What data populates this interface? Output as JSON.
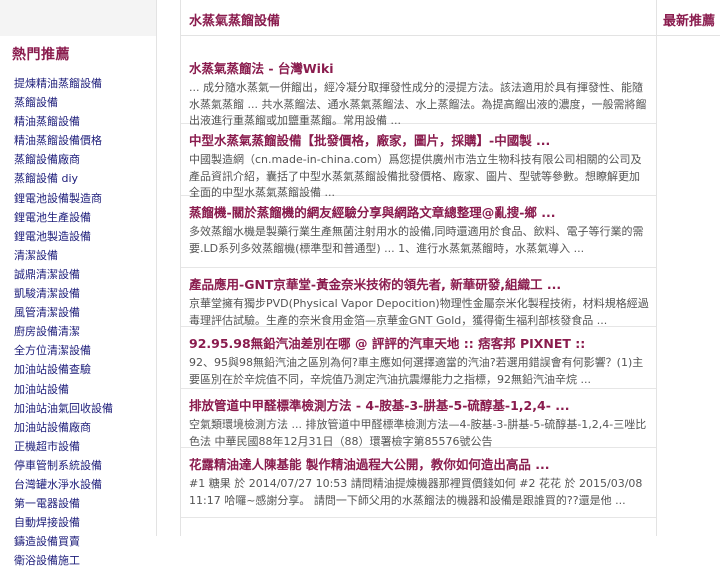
{
  "header": {
    "title": "水蒸氣蒸餾設備",
    "right_title": "最新推薦"
  },
  "sidebar": {
    "title": "熱門推薦",
    "items": [
      "提煉精油蒸餾設備",
      "蒸餾設備",
      "精油蒸餾設備",
      "精油蒸餾設備價格",
      "蒸餾設備廠商",
      "蒸餾設備 diy",
      "鋰電池設備製造商",
      "鋰電池生產設備",
      "鋰電池製造設備",
      "清潔設備",
      "誠鼎清潔設備",
      "凱駿清潔設備",
      "風管清潔設備",
      "廚房設備清潔",
      "全方位清潔設備",
      "加油站設備查驗",
      "加油站設備",
      "加油站油氣回收設備",
      "加油站設備廠商",
      "正機超市設備",
      "停車管制系統設備",
      "台灣罐水淨水設備",
      "第一電器設備",
      "自動焊接設備",
      "鑄造設備買賣",
      "衛浴設備施工"
    ]
  },
  "results": [
    {
      "title": "水蒸氣蒸餾法 - 台灣Wiki",
      "snippet": "... 成分隨水蒸氣一併餾出，經冷凝分取揮發性成分的浸提方法。該法適用於具有揮發性、能隨水蒸氣蒸餾 ... 共水蒸餾法、通水蒸氣蒸餾法、水上蒸餾法。為提高餾出液的濃度，一般需將餾出液進行重蒸餾或加鹽重蒸餾。常用設備 ..."
    },
    {
      "title": "中型水蒸氣蒸餾設備【批發價格，廠家，圖片，採購】-中國製 ...",
      "snippet": "中國製造網（cn.made-in-china.com）爲您提供廣州市浩立生物科技有限公司相關的公司及產品資訊介紹，囊括了中型水蒸氣蒸餾設備批發價格、廠家、圖片、型號等參數。想瞭解更加全面的中型水蒸氣蒸餾設備 ..."
    },
    {
      "title": "蒸餾機-關於蒸餾機的網友經驗分享與網路文章總整理@亂搜-鄉 ...",
      "snippet": "多效蒸餾水機是製藥行業生產無菌注射用水的設備,同時還適用於食品、飲料、電子等行業的需要.LD系列多效蒸餾機(標準型和普通型) ... 1、進行水蒸氣蒸餾時，水蒸氣導入 ..."
    },
    {
      "title": "產品應用-GNT京華堂-黃金奈米技術的領先者, 新華研發,組織工 ...",
      "snippet": "京華堂擁有獨步PVD(Physical Vapor Depocition)物理性金屬奈米化製程技術，材料規格經過毒理評估試驗。生產的奈米食用金箔—京華金GNT Gold，獲得衛生福利部核發食品 ..."
    },
    {
      "title": "92.95.98無鉛汽油差別在哪 @ 評評的汽車天地 :: 痞客邦 PIXNET ::",
      "snippet": "92、95與98無鉛汽油之區別為何?車主應如何選擇適當的汽油?若選用錯誤會有何影響？(1)主要區別在於辛烷值不同，辛烷值乃測定汽油抗震爆能力之指標，92無鉛汽油辛烷 ..."
    },
    {
      "title": "排放管道中甲醛標準檢測方法 - 4-胺基-3-肼基-5-硫醇基-1,2,4- ...",
      "snippet": "空氣類環境檢測方法 ... 排放管道中甲醛標準檢測方法—4-胺基-3-肼基-5-硫醇基-1,2,4-三唑比色法 中華民國88年12月31日（88）環署檢字第85576號公告"
    },
    {
      "title": "花露精油達人陳基能 製作精油過程大公開，教你如何造出高品 ...",
      "snippet": "#1 糖果 於 2014/07/27 10:53 請問精油提煉機器那裡買價錢如何 #2 花花 於 2015/03/08 11:17 哈囉~感謝分享。 請問一下師父用的水蒸餾法的機器和設備是跟誰買的??還是他 ..."
    }
  ]
}
